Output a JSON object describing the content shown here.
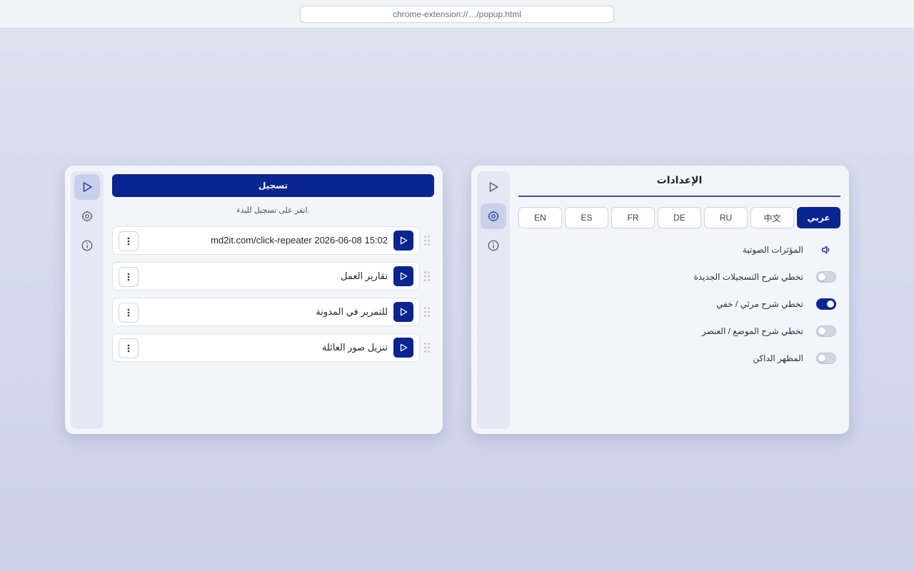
{
  "browser": {
    "url": "chrome-extension://…/popup.html"
  },
  "colors": {
    "accent": "#0a2490",
    "rail_active": "#c9d0ec",
    "background": "#d5d9ed"
  },
  "left_panel": {
    "rail": [
      "play-icon",
      "gear-icon",
      "info-icon"
    ],
    "rail_active_index": 0,
    "record_label": "تسجيل",
    "hint": "انقر على تسجيل للبدء.",
    "recordings": [
      {
        "name": "md2it.com/click-repeater 2026-06-08 15:02"
      },
      {
        "name": "تقارير العمل"
      },
      {
        "name": "للتمرير في المدونة"
      },
      {
        "name": "تنزيل صور العائلة"
      }
    ]
  },
  "right_panel": {
    "rail": [
      "play-icon",
      "gear-icon",
      "info-icon"
    ],
    "rail_active_index": 1,
    "title": "الإعدادات",
    "languages": [
      "عربي",
      "中文",
      "RU",
      "DE",
      "FR",
      "ES",
      "EN"
    ],
    "active_language": "عربي",
    "settings": [
      {
        "label": "المؤثرات الصوتية",
        "control": "speaker-icon"
      },
      {
        "label": "تخطي شرح التسجيلات الجديدة",
        "control": "toggle",
        "on": false
      },
      {
        "label": "تخطي شرح مرئي / خفي",
        "control": "toggle",
        "on": true
      },
      {
        "label": "تخطي شرح الموضع / العنصر",
        "control": "toggle",
        "on": false
      },
      {
        "label": "المظهر الداكن",
        "control": "toggle",
        "on": false
      }
    ]
  }
}
